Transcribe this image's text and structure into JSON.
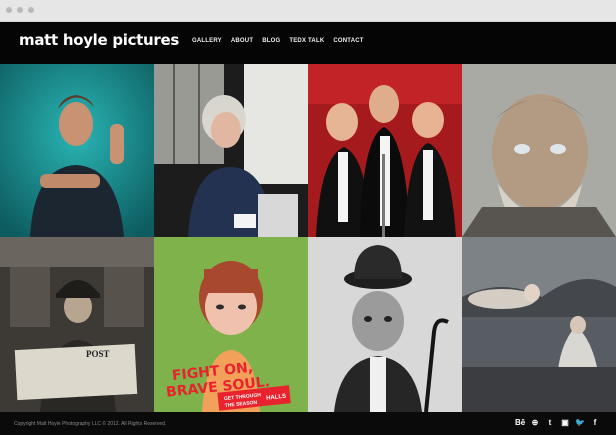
{
  "site": {
    "logo": "matt hoyle pictures",
    "nav": [
      "GALLERY",
      "ABOUT",
      "BLOG",
      "TEDX TALK",
      "CONTACT"
    ]
  },
  "gallery": {
    "poster_text": {
      "line1": "FIGHT ON,",
      "line2": "BRAVE SOUL.",
      "tag_line1": "GET THROUGH",
      "tag_line2": "THE SEASON",
      "brand": "HALLS"
    },
    "newspaper_text": "POST"
  },
  "footer": {
    "copyright": "Copyright Matt Hoyle Photography LLC © 2012. All Rights Reserved.",
    "socials": [
      {
        "icon": "behance-icon",
        "glyph": "Bē"
      },
      {
        "icon": "dribbble-icon",
        "glyph": "⊕"
      },
      {
        "icon": "tumblr-icon",
        "glyph": "t"
      },
      {
        "icon": "instagram-icon",
        "glyph": "▣"
      },
      {
        "icon": "twitter-icon",
        "glyph": "🐦"
      },
      {
        "icon": "facebook-icon",
        "glyph": "f"
      }
    ]
  },
  "colors": {
    "accent_teal": "#1f9aa0",
    "poster_red": "#e8232e",
    "poster_green": "#7fb24a"
  }
}
